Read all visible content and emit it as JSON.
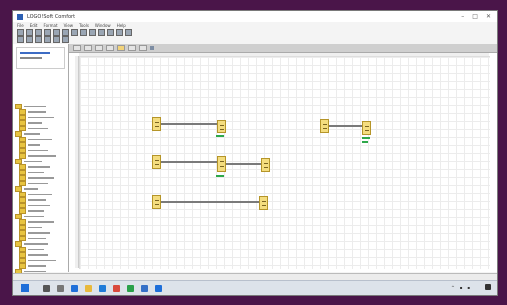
{
  "window": {
    "title": "LOGO!Soft Comfort"
  },
  "menu": {
    "items": [
      "File",
      "Edit",
      "Format",
      "View",
      "Tools",
      "Window",
      "Help"
    ]
  },
  "editor": {
    "tabs": [
      "",
      "",
      "",
      "",
      "",
      "",
      ""
    ],
    "active_tab_index": 4
  },
  "taskbar": {
    "time": "",
    "date": ""
  },
  "colors": {
    "desktop_bg": "#4a1549",
    "block_fill": "#f4dd7f",
    "grid_line": "#ececec",
    "accent_blue": "#1e6fd9"
  }
}
